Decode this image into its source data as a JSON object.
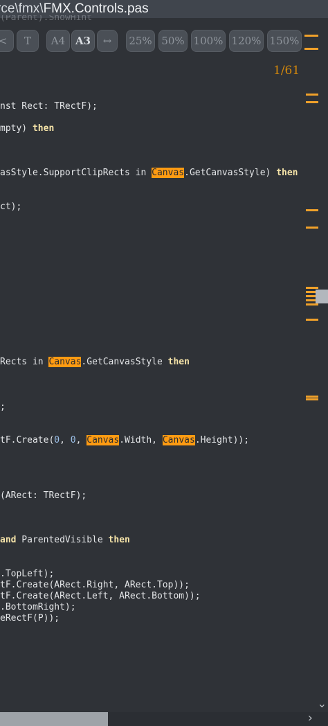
{
  "title": {
    "path": "rce\\fmx\\",
    "filename": "FMX.Controls.pas"
  },
  "ghost_text": "(Parent).ShowHint",
  "toolbar": {
    "share_glyph": "<",
    "t_label": "T",
    "a4_label": "A4",
    "a3_label": "A3",
    "fit_width_glyph": "↔",
    "zoom_25": "25%",
    "zoom_50": "50%",
    "zoom_100": "100%",
    "zoom_120": "120%",
    "zoom_150": "150%"
  },
  "page_indicator": "1/61",
  "code": {
    "l1": "nst Rect: TRectF);",
    "l2a": "mpty) ",
    "l2b": "then",
    "l3a": "asStyle.SupportClipRects in ",
    "l3b": "Canvas",
    "l3c": ".GetCanvasStyle) ",
    "l3d": "then",
    "l4": "ct);",
    "l5a": "Rects in ",
    "l5b": "Canvas",
    "l5c": ".GetCanvasStyle ",
    "l5d": "then",
    "l6": ";",
    "l7a": "tF.Create(",
    "l7b": "0",
    "l7c": ", ",
    "l7d": "0",
    "l7e": ", ",
    "l7f": "Canvas",
    "l7g": ".Width, ",
    "l7h": "Canvas",
    "l7i": ".Height));",
    "l8": "(ARect: TRectF);",
    "l9a": "and",
    "l9b": " ParentedVisible ",
    "l9c": "then",
    "l10": ".TopLeft);",
    "l11": "tF.Create(ARect.Right, ARect.Top));",
    "l12": "tF.Create(ARect.Left, ARect.Bottom));",
    "l13": ".BottomRight);",
    "l14": "eRectF(P));"
  },
  "scroll": {
    "left_glyph": "›",
    "down_glyph": "⌄"
  },
  "colors": {
    "background": "#2f3237",
    "highlight": "#ff9b12",
    "keyword": "#f5e3a8",
    "page_indicator": "#d4880b",
    "ruler_mark": "#f0a12a"
  }
}
